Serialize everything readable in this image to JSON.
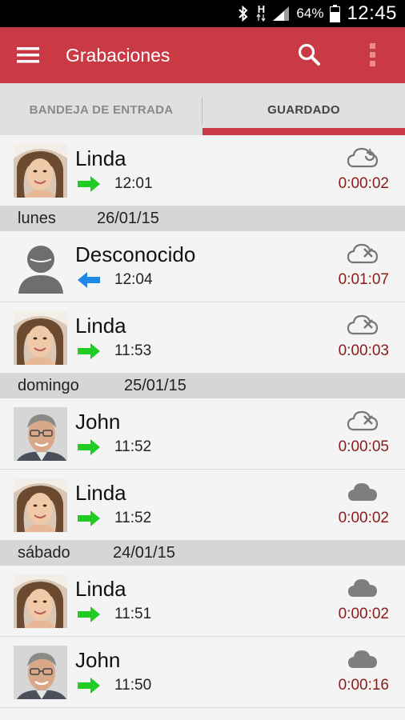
{
  "status_bar": {
    "time": "12:45",
    "battery_percent": "64%",
    "network_type": "H",
    "icons": [
      "bluetooth-icon",
      "data-activity-icon",
      "signal-icon",
      "battery-icon"
    ]
  },
  "toolbar": {
    "title": "Grabaciones",
    "icons": [
      "menu-icon",
      "search-icon",
      "overflow-menu-icon"
    ],
    "color": "#c93a45"
  },
  "tabs": [
    {
      "label": "BANDEJA DE ENTRADA",
      "selected": false
    },
    {
      "label": "GUARDADO",
      "selected": true
    }
  ],
  "colors": {
    "accent": "#c93a45",
    "outgoing_arrow": "#22cc22",
    "incoming_arrow": "#1e88e5",
    "duration_text": "#8b1a1a"
  },
  "list": [
    {
      "type": "call",
      "name": "Linda",
      "time": "12:01",
      "duration": "0:00:02",
      "direction": "outgoing",
      "avatar": "linda",
      "cloud": "cloud-sync-icon"
    },
    {
      "type": "day",
      "day": "lunes",
      "date": "26/01/15"
    },
    {
      "type": "call",
      "name": "Desconocido",
      "time": "12:04",
      "duration": "0:01:07",
      "direction": "incoming",
      "avatar": "unknown",
      "cloud": "cloud-off-icon"
    },
    {
      "type": "call",
      "name": "Linda",
      "time": "11:53",
      "duration": "0:00:03",
      "direction": "outgoing",
      "avatar": "linda",
      "cloud": "cloud-off-icon"
    },
    {
      "type": "day",
      "day": "domingo",
      "date": "25/01/15"
    },
    {
      "type": "call",
      "name": "John",
      "time": "11:52",
      "duration": "0:00:05",
      "direction": "outgoing",
      "avatar": "john",
      "cloud": "cloud-off-icon"
    },
    {
      "type": "call",
      "name": "Linda",
      "time": "11:52",
      "duration": "0:00:02",
      "direction": "outgoing",
      "avatar": "linda",
      "cloud": "cloud-filled-icon"
    },
    {
      "type": "day",
      "day": "sábado",
      "date": "24/01/15"
    },
    {
      "type": "call",
      "name": "Linda",
      "time": "11:51",
      "duration": "0:00:02",
      "direction": "outgoing",
      "avatar": "linda",
      "cloud": "cloud-filled-icon"
    },
    {
      "type": "call",
      "name": "John",
      "time": "11:50",
      "duration": "0:00:16",
      "direction": "outgoing",
      "avatar": "john",
      "cloud": "cloud-filled-icon"
    }
  ]
}
